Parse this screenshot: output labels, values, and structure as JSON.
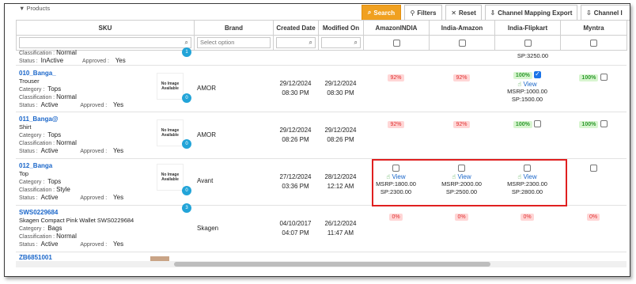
{
  "crumb": "▼ Products",
  "toolbar": {
    "search": "Search",
    "filters": "Filters",
    "reset": "Reset",
    "channel_mapping_export": "Channel Mapping Export",
    "channel_partial": "Channel I"
  },
  "columns": {
    "sku": "SKU",
    "brand": "Brand",
    "created": "Created Date",
    "modified": "Modified On",
    "ch1": "AmazonINDIA",
    "ch2": "India-Amazon",
    "ch3": "India-Flipkart",
    "ch4": "Myntra"
  },
  "filters": {
    "brand_placeholder": "Select option"
  },
  "labels": {
    "classification": "Classification :",
    "status": "Status :",
    "approved": "Approved :",
    "category": "Category :",
    "no_image": "No Image Available",
    "view": "View"
  },
  "rows": [
    {
      "partial": true,
      "classification": "Normal",
      "status": "InActive",
      "approved": "Yes",
      "flipkart_sp": "SP:3250.00",
      "badge": "1"
    },
    {
      "sku": "010_Banga_",
      "name": "Trouser",
      "category": "Tops",
      "classification": "Normal",
      "status": "Active",
      "approved": "Yes",
      "badge": "0",
      "brand": "AMOR",
      "created_date": "29/12/2024",
      "created_time": "08:30 PM",
      "modified_date": "29/12/2024",
      "modified_time": "08:30 PM",
      "ch1_pct": "92%",
      "ch2_pct": "92%",
      "ch3_pct": "100%",
      "ch3_mrsp": "MSRP:1000.00",
      "ch3_sp": "SP:1500.00",
      "ch4_pct": "100%"
    },
    {
      "sku": "011_Banga@",
      "name": "Shirt",
      "category": "Tops",
      "classification": "Normal",
      "status": "Active",
      "approved": "Yes",
      "badge": "0",
      "brand": "AMOR",
      "created_date": "29/12/2024",
      "created_time": "08:26 PM",
      "modified_date": "29/12/2024",
      "modified_time": "08:26 PM",
      "ch1_pct": "92%",
      "ch2_pct": "92%",
      "ch3_pct": "100%",
      "ch4_pct": "100%"
    },
    {
      "sku": "012_Banga",
      "name": "Top",
      "category": "Tops",
      "classification": "Style",
      "status": "Active",
      "approved": "Yes",
      "badge": "0",
      "brand": "Avant",
      "created_date": "27/12/2024",
      "created_time": "03:36 PM",
      "modified_date": "28/12/2024",
      "modified_time": "12:12 AM",
      "ch1_mrsp": "MSRP:1800.00",
      "ch1_sp": "SP:2300.00",
      "ch2_mrsp": "MSRP:2000.00",
      "ch2_sp": "SP:2500.00",
      "ch3_mrsp": "MSRP:2300.00",
      "ch3_sp": "SP:2800.00"
    },
    {
      "sku": "SWS0229684",
      "name": "Skagen Compact Pink Wallet SWS0229684",
      "category": "Bags",
      "classification": "Normal",
      "status": "Active",
      "approved": "Yes",
      "badge": "3",
      "brand": "Skagen",
      "created_date": "04/10/2017",
      "created_time": "04:07 PM",
      "modified_date": "26/12/2024",
      "modified_time": "11:47 AM",
      "ch1_pct": "0%",
      "ch2_pct": "0%",
      "ch3_pct": "0%",
      "ch4_pct": "0%"
    },
    {
      "sku": "ZB6851001",
      "partial_bottom": true
    }
  ]
}
